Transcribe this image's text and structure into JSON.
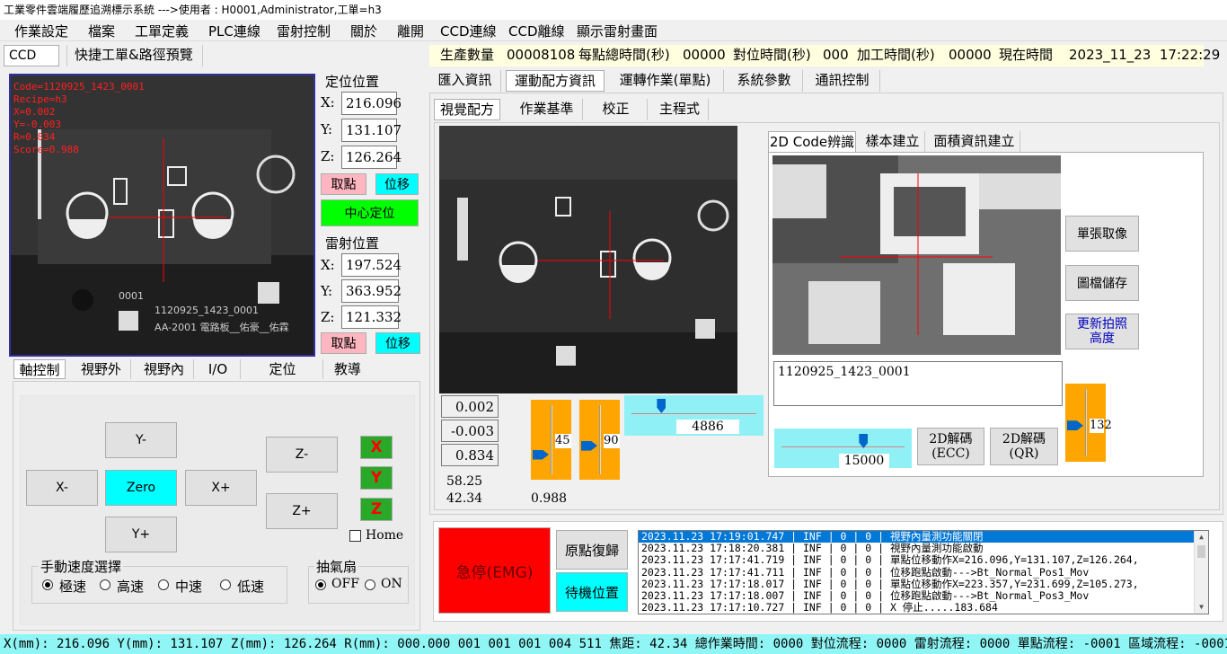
{
  "window": {
    "title": "工業零件雲端履歷追溯標示系統 --->使用者 : H0001,Administrator,工單=h3"
  },
  "menu": [
    "作業設定",
    "檔案",
    "工單定義",
    "PLC連線",
    "雷射控制",
    "關於",
    "離開",
    "CCD連線",
    "CCD離線",
    "顯示雷射畫面"
  ],
  "toolbar": {
    "ccd_label": "CCD",
    "quick_button": "快捷工單&路徑預覽"
  },
  "infobar": {
    "items": [
      {
        "label": "生產數量",
        "value": "00008108"
      },
      {
        "label": "每點總時間(秒)",
        "value": "00000"
      },
      {
        "label": "對位時間(秒)",
        "value": "000"
      },
      {
        "label": "加工時間(秒)",
        "value": "00000"
      },
      {
        "label": "現在時間",
        "value": "2023_11_23  17:22:29"
      }
    ]
  },
  "camera_left": {
    "overlay": [
      "Code=1120925_1423_0001",
      "Recipe=h3",
      "X=0.002",
      "Y=-0.003",
      "R=0.834",
      "Score=0.988"
    ],
    "board_text": [
      "0001",
      "1120925_1423_0001",
      "AA-2001  電路板__佑豪__佑霖"
    ]
  },
  "position": {
    "title": "定位位置",
    "x": "216.096",
    "y": "131.107",
    "z": "126.264",
    "cancel": "取點",
    "move": "位移",
    "center": "中心定位"
  },
  "laser": {
    "title": "雷射位置",
    "x": "197.524",
    "y": "363.952",
    "z": "121.332",
    "cancel": "取點",
    "move": "位移"
  },
  "axis_labels": {
    "x": "X:",
    "y": "Y:",
    "z": "Z:"
  },
  "left_tabs": [
    "軸控制",
    "視野外",
    "視野內",
    "I/O",
    "定位",
    "教導"
  ],
  "jog": {
    "y_minus": "Y-",
    "y_plus": "Y+",
    "x_minus": "X-",
    "x_plus": "X+",
    "zero": "Zero",
    "z_minus": "Z-",
    "z_plus": "Z+",
    "x_axis": "X",
    "y_axis": "Y",
    "z_axis": "Z",
    "home": "Home"
  },
  "speed": {
    "title": "手動速度選擇",
    "options": [
      "極速",
      "高速",
      "中速",
      "低速"
    ],
    "selected": "極速"
  },
  "fan": {
    "title": "抽氣扇",
    "options": [
      "OFF",
      "ON"
    ],
    "selected": "OFF"
  },
  "right_tabs": [
    "匯入資訊",
    "運動配方資訊",
    "運轉作業(單點)",
    "系統參數",
    "通訊控制"
  ],
  "sub_tabs": [
    "視覺配方",
    "作業基準",
    "校正",
    "主程式"
  ],
  "code_tabs": [
    "2D Code辨識",
    "樣本建立",
    "面積資訊建立"
  ],
  "vision": {
    "vals": [
      "0.002",
      "-0.003",
      "0.834"
    ],
    "focus": "58.25",
    "focus2": "42.34",
    "score": "0.988",
    "slider1": "45",
    "slider2": "90",
    "slider3": "4886",
    "slider4": "15000",
    "slider5": "132",
    "slider_fracs": {
      "s1": 0.75,
      "s2": 0.6,
      "s3": 0.22,
      "s4": 0.68,
      "s5": 0.55
    }
  },
  "code_panel": {
    "decoded": "1120925_1423_0001",
    "grab": "單張取像",
    "save": "圖檔儲存",
    "refresh": "更新拍照\n高度",
    "ecc": "2D解碼\n(ECC)",
    "qr": "2D解碼\n(QR)"
  },
  "emergency": {
    "emg": "急停(EMG)",
    "home": "原點復歸",
    "standby": "待機位置"
  },
  "log": [
    "2023.11.23 17:19:01.747 | INF | 0 | 0 | 視野內量測功能關閉",
    "2023.11.23 17:18:20.381 | INF | 0 | 0 | 視野內量測功能啟動",
    "2023.11.23 17:17:41.719 | INF | 0 | 0 | 單點位移動作X=216.096,Y=131.107,Z=126.264,",
    "2023.11.23 17:17:41.711 | INF | 0 | 0 | 位移跑點啟動--->Bt_Normal_Pos1_Mov",
    "2023.11.23 17:17:18.017 | INF | 0 | 0 | 單點位移動作X=223.357,Y=231.699,Z=105.273,",
    "2023.11.23 17:17:18.007 | INF | 0 | 0 | 位移跑點啟動--->Bt_Normal_Pos3_Mov",
    "2023.11.23 17:17:10.727 | INF | 0 | 0 | X  停止.....183.684"
  ],
  "status": "X(mm): 216.096 Y(mm): 131.107 Z(mm): 126.264 R(mm): 000.000 001 001 001 004 511 焦距: 42.34 總作業時間: 0000 對位流程: 0000 雷射流程: 0000 單點流程: -0001 區域流程: -0001",
  "colors": {
    "accent_cyan": "#00ffff",
    "pink": "#ffb6c1",
    "green": "#00ff00",
    "orange": "#ffa500",
    "red": "#ff0000",
    "status_bg": "#8ff5f5"
  }
}
